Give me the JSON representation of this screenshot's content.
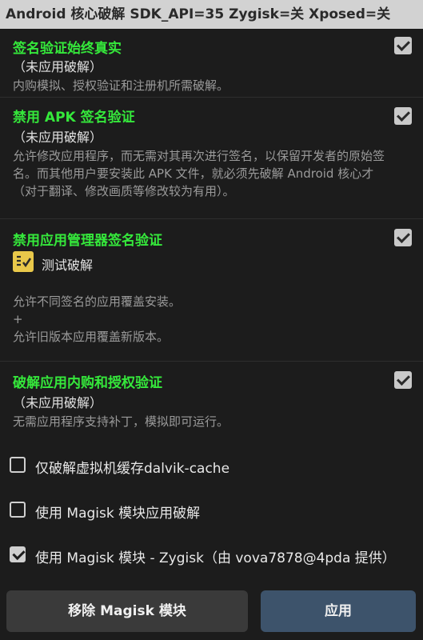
{
  "titlebar": {
    "text": "Android 核心破解 SDK_API=35 Zygisk=关 Xposed=关"
  },
  "sections": [
    {
      "title": "签名验证始终真实",
      "sub": "（未应用破解）",
      "desc": "内购模拟、授权验证和注册机所需破解。",
      "checked": true
    },
    {
      "title": "禁用 APK 签名验证",
      "sub": "（未应用破解）",
      "desc": "允许修改应用程序，而无需对其再次进行签名，以保留开发者的原始签名。而其他用户要安装此 APK 文件，就必须先破解 Android 核心才（对于翻译、修改画质等修改较为有用）。",
      "checked": true
    },
    {
      "title": "禁用应用管理器签名验证",
      "sub": "测试破解",
      "desc": "允许不同签名的应用覆盖安装。\n+\n允许旧版本应用覆盖新版本。",
      "checked": true
    },
    {
      "title": "破解应用内购和授权验证",
      "sub": "（未应用破解）",
      "desc": "无需应用程序支持补丁，模拟即可运行。",
      "checked": true
    }
  ],
  "options": [
    {
      "label": "仅破解虚拟机缓存dalvik-cache",
      "checked": false
    },
    {
      "label": "使用 Magisk 模块应用破解",
      "checked": false
    },
    {
      "label": "使用 Magisk 模块 - Zygisk（由 vova7878@4pda 提供）",
      "checked": true
    }
  ],
  "buttons": {
    "remove": "移除 Magisk 模块",
    "apply": "应用"
  }
}
